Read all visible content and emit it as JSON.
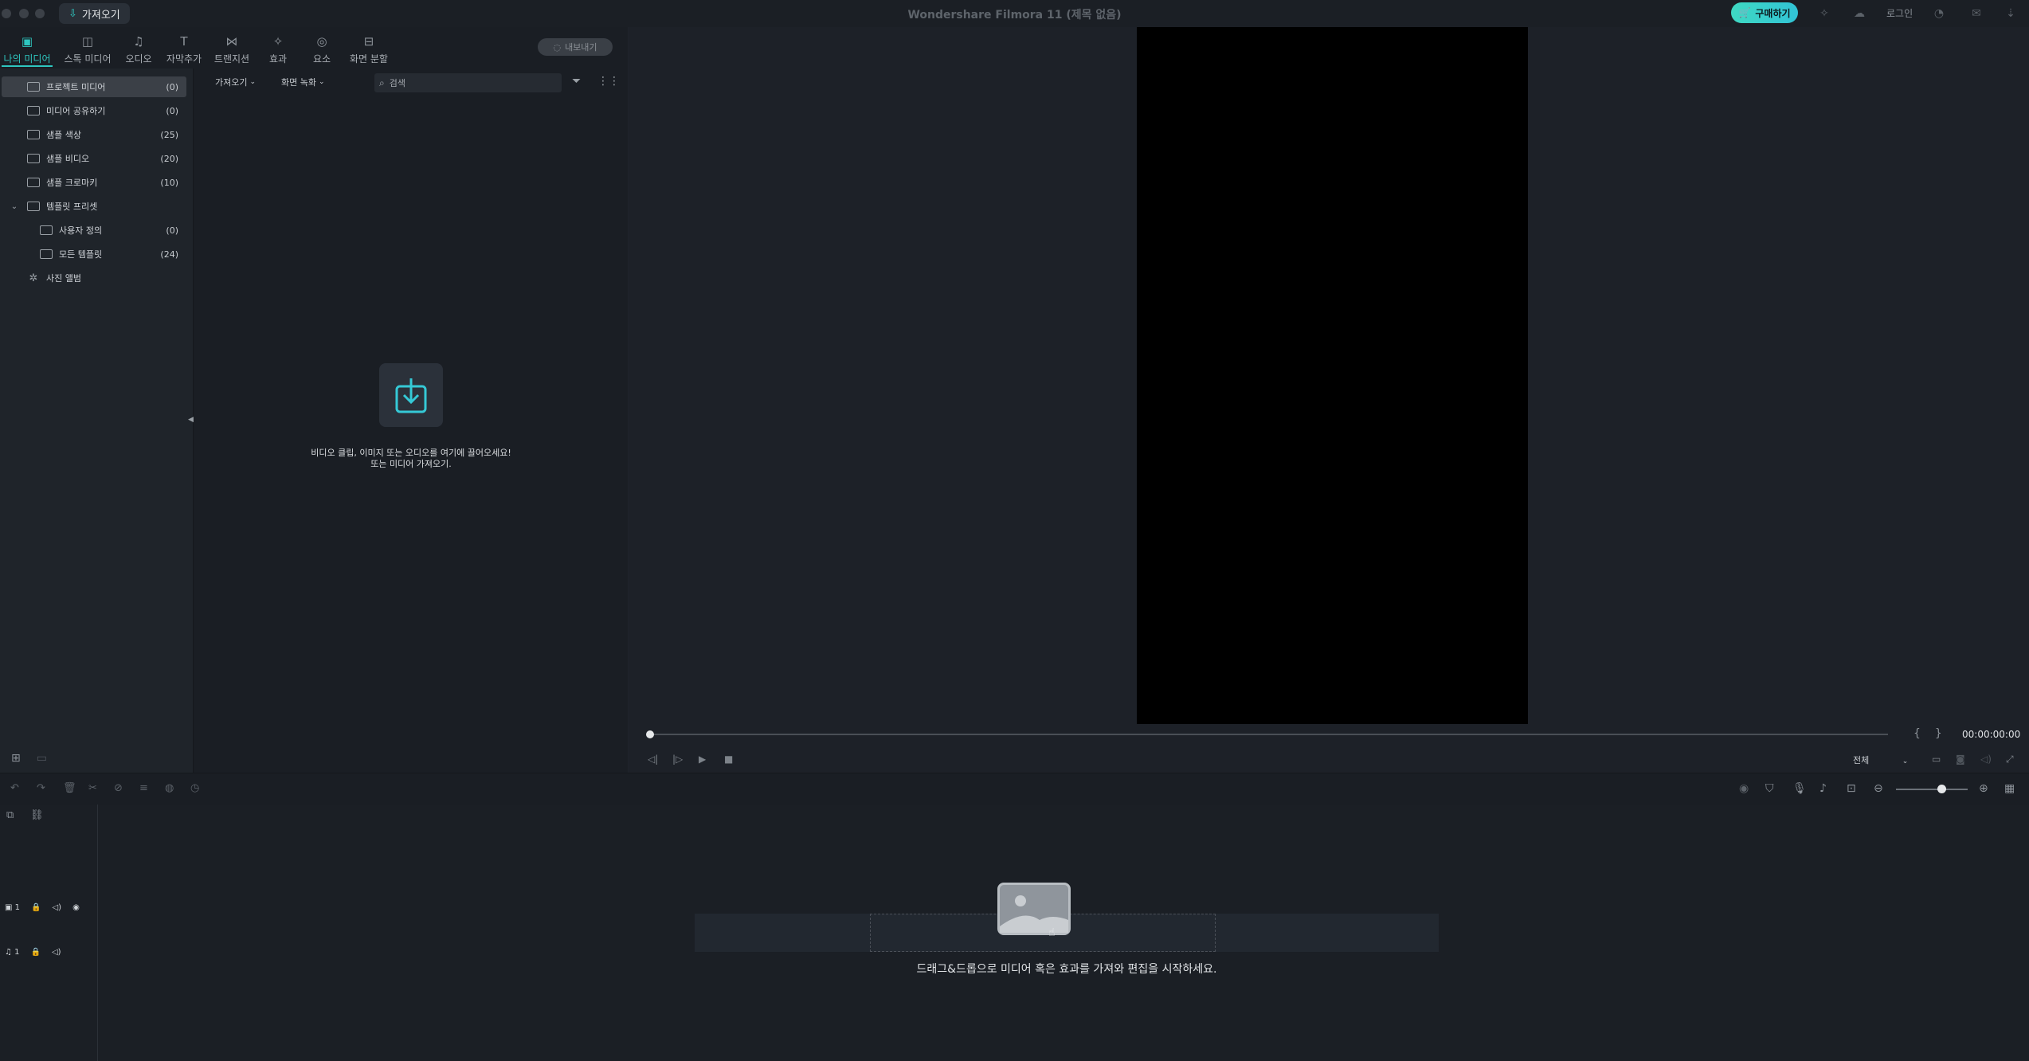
{
  "titlebar": {
    "import_label": "가져오기",
    "app_title": "Wondershare Filmora 11 (제목 없음)",
    "buy_label": "구매하기",
    "login_label": "로그인"
  },
  "tabs": [
    {
      "label": "나의 미디어",
      "icon": "image-icon"
    },
    {
      "label": "스톡 미디어",
      "icon": "stock-icon"
    },
    {
      "label": "오디오",
      "icon": "music-icon"
    },
    {
      "label": "자막추가",
      "icon": "text-icon"
    },
    {
      "label": "트랜지션",
      "icon": "transition-icon"
    },
    {
      "label": "효과",
      "icon": "effects-icon"
    },
    {
      "label": "요소",
      "icon": "elements-icon"
    },
    {
      "label": "화면 분할",
      "icon": "split-screen-icon"
    }
  ],
  "export_label": "내보내기",
  "sidebar": {
    "items": [
      {
        "label": "프로젝트 미디어",
        "count": "(0)"
      },
      {
        "label": "미디어 공유하기",
        "count": "(0)"
      },
      {
        "label": "샘플 색상",
        "count": "(25)"
      },
      {
        "label": "샘플 비디오",
        "count": "(20)"
      },
      {
        "label": "샘플 크로마키",
        "count": "(10)"
      },
      {
        "label": "템플릿 프리셋",
        "count": ""
      },
      {
        "label": "사용자 정의",
        "count": "(0)"
      },
      {
        "label": "모든 템플릿",
        "count": "(24)"
      },
      {
        "label": "사진 앨범",
        "count": ""
      }
    ]
  },
  "media_toolbar": {
    "import_dropdown": "가져오기",
    "record_dropdown": "화면 녹화",
    "search_placeholder": "검색"
  },
  "empty_media": {
    "line1": "비디오 클립, 이미지 또는 오디오를 여기에 끌어오세요!",
    "line2": "또는 미디어 가져오기."
  },
  "preview": {
    "timecode": "00:00:00:00",
    "quality": "전체",
    "progress": 0
  },
  "timeline": {
    "video_track": "1",
    "audio_track": "1",
    "zoom_level": 0.7,
    "empty_message": "드래그&드롭으로 미디어 혹은 효과를 가져와 편집을 시작하세요."
  }
}
